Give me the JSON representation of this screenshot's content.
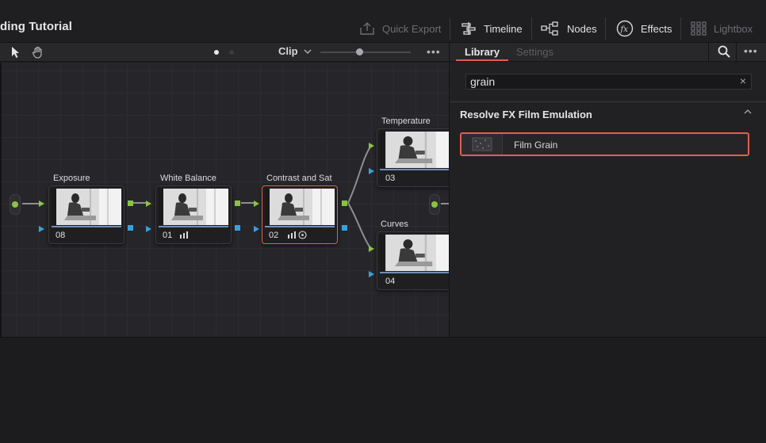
{
  "header": {
    "project_title": "ding Tutorial",
    "buttons": [
      {
        "label": "Quick Export",
        "icon": "export-icon"
      },
      {
        "label": "Timeline",
        "icon": "timeline-icon"
      },
      {
        "label": "Nodes",
        "icon": "nodes-icon"
      },
      {
        "label": "Effects",
        "icon": "fx-icon"
      },
      {
        "label": "Lightbox",
        "icon": "grid-icon"
      }
    ]
  },
  "node_toolbar": {
    "mode_label": "Clip",
    "more": "•••"
  },
  "panel": {
    "tabs": [
      {
        "label": "Library"
      },
      {
        "label": "Settings"
      }
    ],
    "more": "•••",
    "search": {
      "value": "grain",
      "clear": "×"
    },
    "section_title": "Resolve FX Film Emulation",
    "items": [
      {
        "label": "Film Grain"
      }
    ]
  },
  "nodes": [
    {
      "label": "Exposure",
      "number": "08"
    },
    {
      "label": "White Balance",
      "number": "01"
    },
    {
      "label": "Contrast and Sat",
      "number": "02"
    },
    {
      "label": "Temperature",
      "number": "03"
    },
    {
      "label": "Curves",
      "number": "04"
    }
  ],
  "colors": {
    "accent": "#e0604e",
    "rgb_pin": "#8bc441",
    "alpha_pin": "#3aa0dc",
    "node_bar": "#6c8fb7"
  }
}
